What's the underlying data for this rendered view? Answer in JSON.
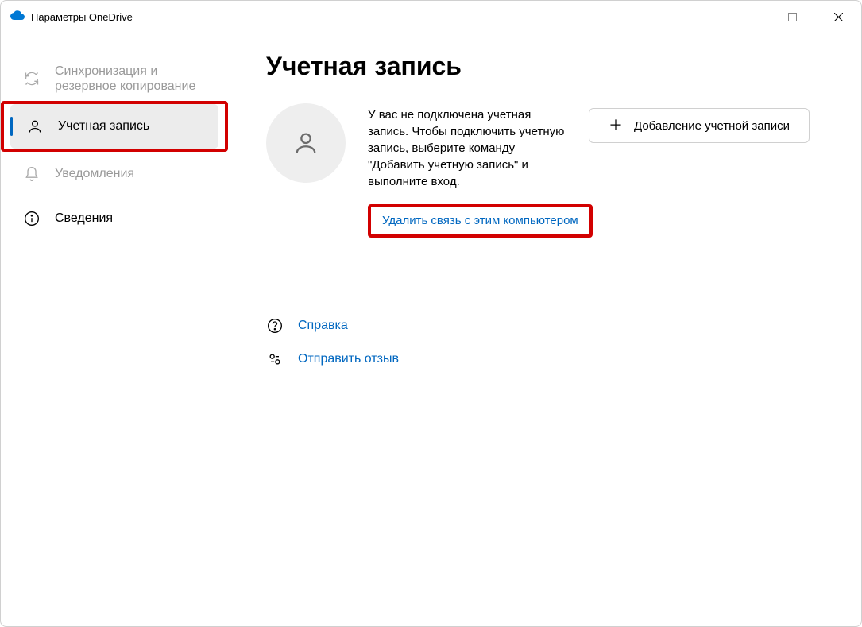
{
  "window": {
    "title": "Параметры OneDrive"
  },
  "sidebar": {
    "items": [
      {
        "label": "Синхронизация и\nрезервное копирование"
      },
      {
        "label": "Учетная запись"
      },
      {
        "label": "Уведомления"
      },
      {
        "label": "Сведения"
      }
    ]
  },
  "main": {
    "title": "Учетная запись",
    "account_message": "У вас не подключена учетная запись. Чтобы подключить учетную запись, выберите команду \"Добавить учетную запись\" и выполните вход.",
    "add_account_label": "Добавление учетной записи",
    "unlink_label": "Удалить связь с этим компьютером",
    "help_label": "Справка",
    "feedback_label": "Отправить отзыв"
  }
}
